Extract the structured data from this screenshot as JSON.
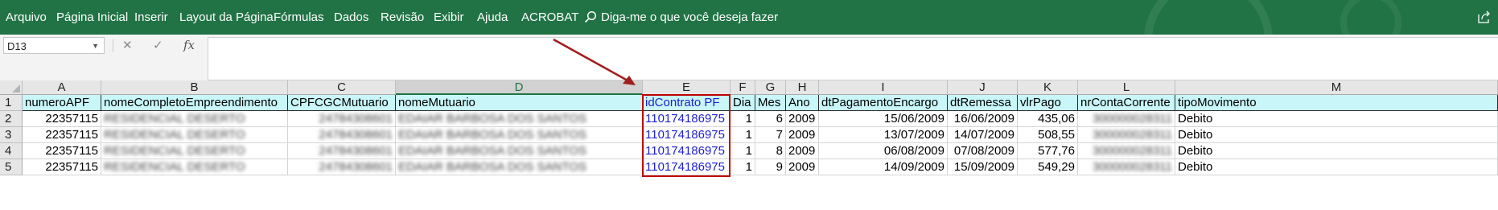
{
  "ribbon": {
    "tabs": [
      "Arquivo",
      "Página Inicial",
      "Inserir",
      "Layout da Página",
      "Fórmulas",
      "Dados",
      "Revisão",
      "Exibir",
      "Ajuda",
      "ACROBAT"
    ],
    "tellme": "Diga-me o que você deseja fazer",
    "share_icon": "share-icon",
    "background": "#217346"
  },
  "formula_bar": {
    "name_box": "D13",
    "value": ""
  },
  "columns": [
    "A",
    "B",
    "C",
    "D",
    "E",
    "F",
    "G",
    "H",
    "I",
    "J",
    "K",
    "L",
    "M"
  ],
  "rows": [
    {
      "n": "1",
      "cells": [
        "numeroAPF",
        "nomeCompletoEmpreendimento",
        "CPFCGCMutuario",
        "nomeMutuario",
        "idContrato PF",
        "Dia",
        "Mes",
        "Ano",
        "dtPagamentoEncargo",
        "dtRemessa",
        "vlrPago",
        "nrContaCorrente",
        "tipoMovimento"
      ]
    },
    {
      "n": "2",
      "cells": [
        "22357115",
        "RESIDENCIAL DESERTO",
        "24784308601",
        "EDAIAR BARBOSA DOS SANTOS",
        "110174186975",
        "1",
        "6",
        "2009",
        "15/06/2009",
        "16/06/2009",
        "435,06",
        "300000028311",
        "Debito"
      ]
    },
    {
      "n": "3",
      "cells": [
        "22357115",
        "RESIDENCIAL DESERTO",
        "24784308601",
        "EDAIAR BARBOSA DOS SANTOS",
        "110174186975",
        "1",
        "7",
        "2009",
        "13/07/2009",
        "14/07/2009",
        "508,55",
        "300000028311",
        "Debito"
      ]
    },
    {
      "n": "4",
      "cells": [
        "22357115",
        "RESIDENCIAL DESERTO",
        "24784308601",
        "EDAIAR BARBOSA DOS SANTOS",
        "110174186975",
        "1",
        "8",
        "2009",
        "06/08/2009",
        "07/08/2009",
        "577,76",
        "300000028311",
        "Debito"
      ]
    },
    {
      "n": "5",
      "cells": [
        "22357115",
        "RESIDENCIAL DESERTO",
        "24784308601",
        "EDAIAR BARBOSA DOS SANTOS",
        "110174186975",
        "1",
        "9",
        "2009",
        "14/09/2009",
        "15/09/2009",
        "549,29",
        "300000028311",
        "Debito"
      ]
    }
  ],
  "colors": {
    "header_fill": "#c9f6f8",
    "link": "#1f1fd1",
    "highlight": "#c00000",
    "selected_col": "#217346"
  }
}
